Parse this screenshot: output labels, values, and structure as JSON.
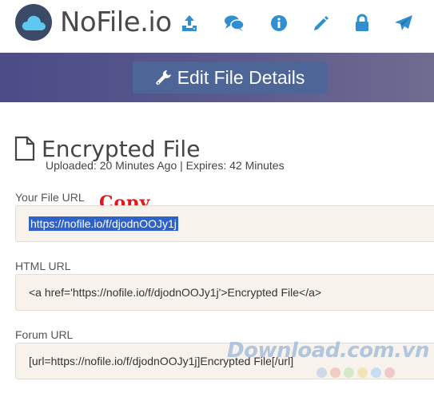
{
  "brand": {
    "name": "NoFile.io",
    "accent": "#2f8fcf"
  },
  "nav": [
    {
      "icon": "upload-icon"
    },
    {
      "icon": "chat-icon"
    },
    {
      "icon": "info-icon"
    },
    {
      "icon": "pencil-icon"
    },
    {
      "icon": "lock-icon"
    },
    {
      "icon": "paper-plane-icon"
    }
  ],
  "banner": {
    "button_label": "Edit File Details",
    "icon": "wrench-icon"
  },
  "file": {
    "title": "Encrypted File",
    "meta": "Uploaded: 20 Minutes Ago | Expires: 42 Minutes"
  },
  "fields": {
    "file_url": {
      "label": "Your File URL",
      "value": "https://nofile.io/f/djodnOOJy1j"
    },
    "html_url": {
      "label": "HTML URL",
      "value": "<a href='https://nofile.io/f/djodnOOJy1j'>Encrypted File</a>"
    },
    "forum_url": {
      "label": "Forum URL",
      "value": "[url=https://nofile.io/f/djodnOOJy1j]Encrypted File[/url]"
    }
  },
  "annotation": {
    "copy_label": "Copy",
    "color": "#e01818"
  },
  "watermark": {
    "text": "Download.com.vn"
  }
}
